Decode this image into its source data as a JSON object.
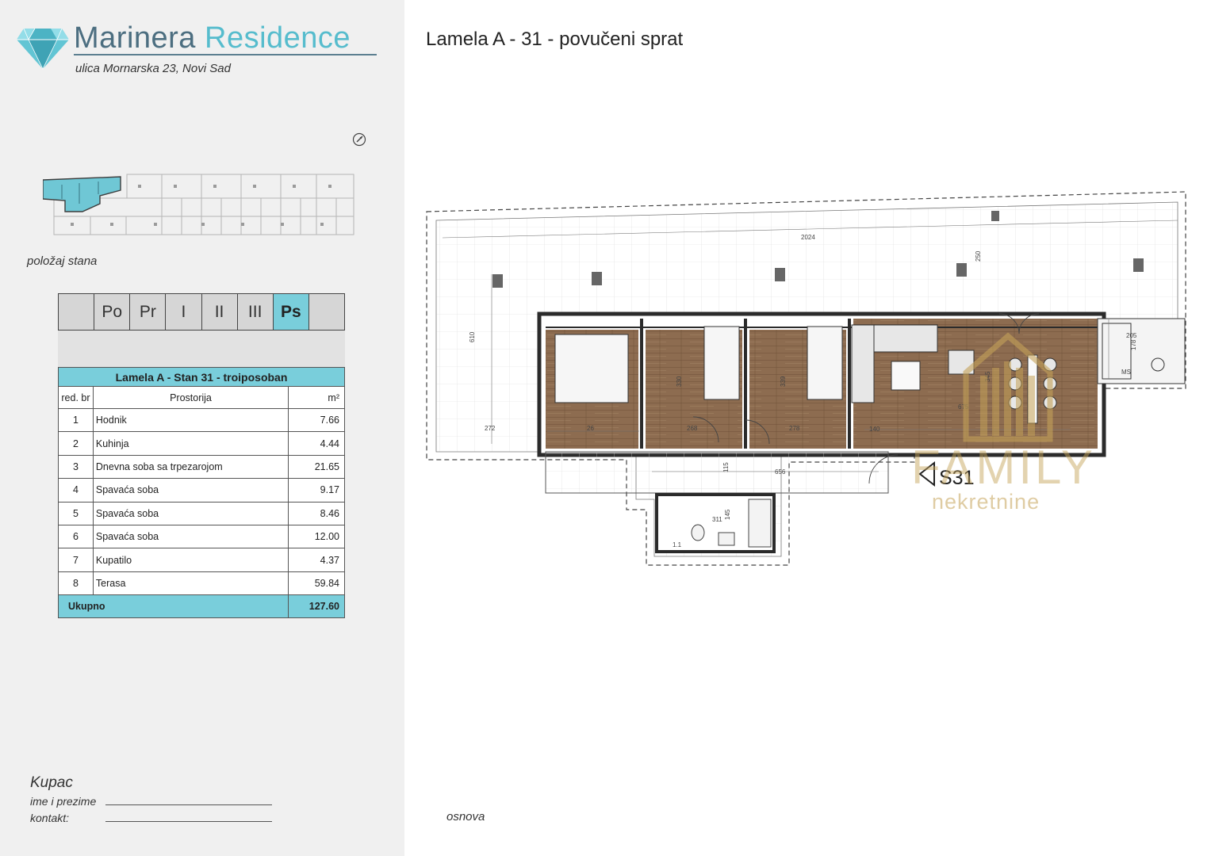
{
  "brand": {
    "name_part1": "Marinera",
    "name_part2": "Residence",
    "address": "ulica Mornarska 23, Novi Sad",
    "color_primary": "#4c6e80",
    "color_accent": "#56bccd"
  },
  "icons": {
    "logo": "diamond-icon",
    "compass": "compass-icon"
  },
  "keyplan": {
    "label": "položaj stana"
  },
  "floors": {
    "tabs": [
      "Po",
      "Pr",
      "I",
      "II",
      "III",
      "Ps"
    ],
    "selected": "Ps"
  },
  "table": {
    "caption": "Lamela A - Stan 31 - troiposoban",
    "headers": {
      "no": "red. br",
      "room": "Prostorija",
      "area": "m²"
    },
    "rows": [
      {
        "no": "1",
        "room": "Hodnik",
        "area": "7.66"
      },
      {
        "no": "2",
        "room": "Kuhinja",
        "area": "4.44"
      },
      {
        "no": "3",
        "room": "Dnevna soba sa trpezarojom",
        "area": "21.65"
      },
      {
        "no": "4",
        "room": "Spavaća soba",
        "area": "9.17"
      },
      {
        "no": "5",
        "room": "Spavaća soba",
        "area": "8.46"
      },
      {
        "no": "6",
        "room": "Spavaća soba",
        "area": "12.00"
      },
      {
        "no": "7",
        "room": "Kupatilo",
        "area": "4.37"
      },
      {
        "no": "8",
        "room": "Terasa",
        "area": "59.84"
      }
    ],
    "total_label": "Ukupno",
    "total_value": "127.60",
    "highlight_color": "#79cedb"
  },
  "buyer": {
    "title": "Kupac",
    "name_label": "ime i prezime",
    "contact_label": "kontakt:"
  },
  "plan": {
    "title": "Lamela A - 31 - povučeni sprat",
    "unit_label": "S31",
    "footer_label": "osnova",
    "dimensions": [
      "2024",
      "250",
      "610",
      "272",
      "205",
      "178",
      "345",
      "675",
      "140",
      "330",
      "339",
      "278",
      "268",
      "26",
      "656",
      "115",
      "145",
      "311",
      "MS",
      "1.1"
    ],
    "floor_color": "#8a6a4f"
  },
  "watermark": {
    "line1": "FAMILY",
    "line2": "nekretnine",
    "color": "#c4a258"
  }
}
